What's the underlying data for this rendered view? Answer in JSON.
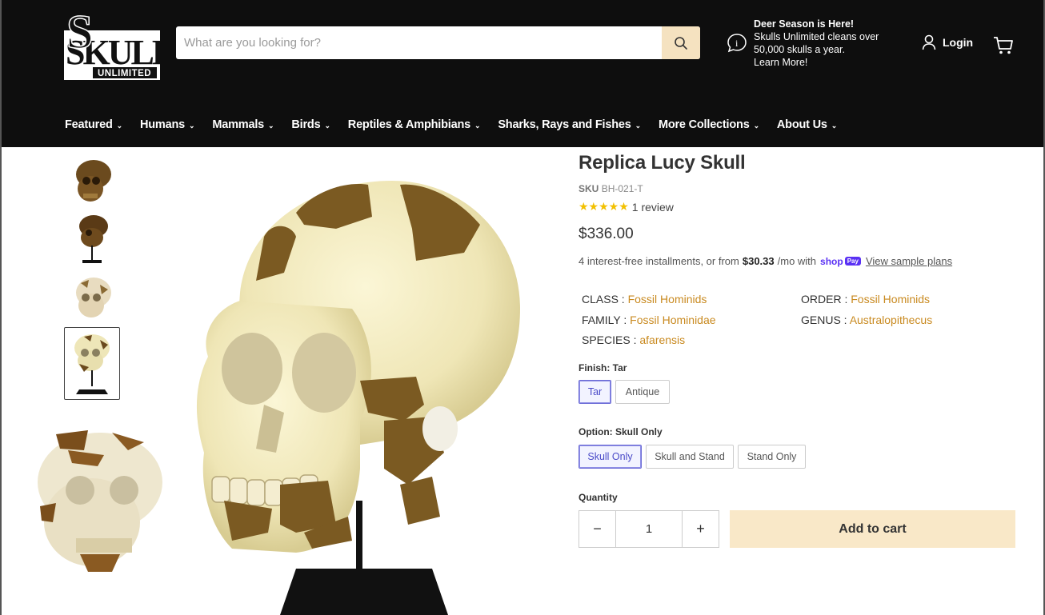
{
  "header": {
    "logo": {
      "line1": "SKULLS",
      "line2": "UNLIMITED"
    },
    "search": {
      "placeholder": "What are you looking for?"
    },
    "promo": {
      "title": "Deer Season is Here!",
      "line1": "Skulls Unlimited cleans over",
      "line2": "50,000 skulls a year.",
      "line3": "Learn More!"
    },
    "login_label": "Login"
  },
  "nav": [
    {
      "label": "Featured"
    },
    {
      "label": "Humans"
    },
    {
      "label": "Mammals"
    },
    {
      "label": "Birds"
    },
    {
      "label": "Reptiles & Amphibians"
    },
    {
      "label": "Sharks, Rays and Fishes"
    },
    {
      "label": "More Collections"
    },
    {
      "label": "About Us"
    }
  ],
  "product": {
    "title": "Replica Lucy Skull",
    "sku_label": "SKU",
    "sku": "BH-021-T",
    "stars": "★★★★★",
    "rating": 5,
    "reviews": "1 review",
    "price": "$336.00",
    "installments": {
      "prefix": "4 interest-free installments, or from",
      "amount": "$30.33",
      "suffix": "/mo with",
      "shop": "shop",
      "pay": "Pay",
      "link": "View sample plans"
    },
    "taxonomy": {
      "class_label": "CLASS : ",
      "class": "Fossil Hominids",
      "order_label": "ORDER : ",
      "order": "Fossil Hominids",
      "family_label": "FAMILY : ",
      "family": "Fossil Hominidae",
      "genus_label": "GENUS : ",
      "genus": "Australopithecus",
      "species_label": "SPECIES : ",
      "species": "afarensis"
    },
    "finish": {
      "label": "Finish:",
      "selected": "Tar",
      "options": [
        "Tar",
        "Antique"
      ]
    },
    "option": {
      "label": "Option:",
      "selected": "Skull Only",
      "options": [
        "Skull Only",
        "Skull and Stand",
        "Stand Only"
      ]
    },
    "quantity_label": "Quantity",
    "quantity": "1",
    "minus": "−",
    "plus": "+",
    "add_to_cart": "Add to cart"
  },
  "colors": {
    "header_bg": "#0e0e0e",
    "accent": "#f5e2c0",
    "link": "#c98a20",
    "selected": "#6b6bd6"
  }
}
